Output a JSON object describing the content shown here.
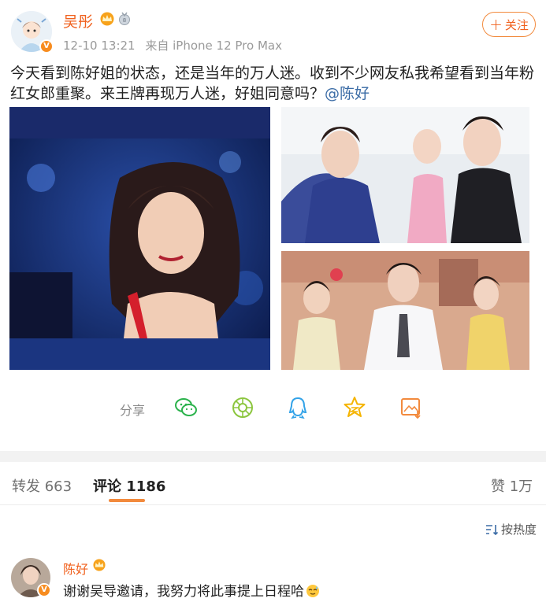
{
  "post": {
    "author": "吴彤",
    "time": "12-10 13:21",
    "source": "来自 iPhone 12 Pro Max",
    "follow_label": "关注",
    "text": "今天看到陈好姐的状态，还是当年的万人迷。收到不少网友私我希望看到当年粉红女郎重聚。来王牌再现万人迷，好姐同意吗？",
    "mention": "@陈好"
  },
  "share": {
    "label": "分享",
    "targets": [
      "wechat-icon",
      "moments-icon",
      "qq-icon",
      "qzone-icon",
      "save-image-icon"
    ]
  },
  "tabs": [
    {
      "label": "转发",
      "count": "663"
    },
    {
      "label": "评论",
      "count": "1186"
    },
    {
      "label": "赞",
      "count": "1万"
    }
  ],
  "sort": {
    "label": "按热度"
  },
  "comment": {
    "author": "陈好",
    "text": "谢谢吴导邀请，我努力将此事提上日程哈"
  },
  "colors": {
    "accent": "#f0611e",
    "mention": "#3b6ca6",
    "tab_indicator": "#f28a3d"
  }
}
